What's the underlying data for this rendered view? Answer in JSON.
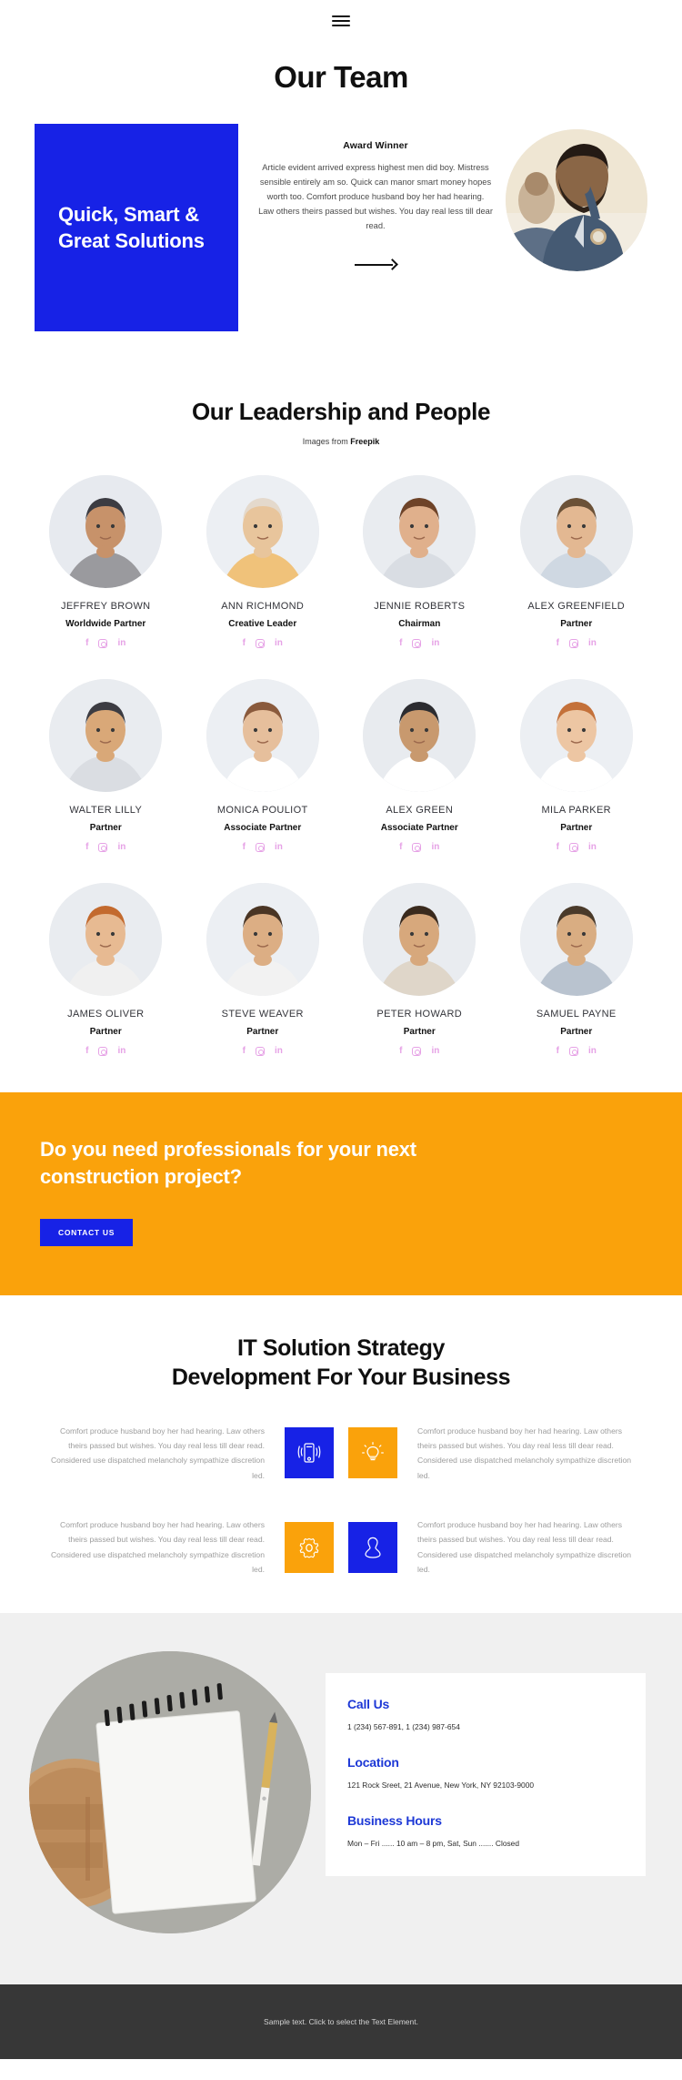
{
  "nav": {
    "menu_icon": "hamburger-icon"
  },
  "hero": {
    "title": "Our Team",
    "card_heading": "Quick, Smart & Great Solutions",
    "award_label": "Award Winner",
    "body": "Article evident arrived express highest men did boy. Mistress sensible entirely am so. Quick can manor smart money hopes worth too. Comfort produce husband boy her had hearing. Law others theirs passed but wishes. You day real less till dear read.",
    "arrow_icon": "arrow-right-icon",
    "photo_alt": "hero-portrait"
  },
  "leadership": {
    "title": "Our Leadership and People",
    "credit_prefix": "Images from ",
    "credit_source": "Freepik",
    "members": [
      {
        "name": "JEFFREY BROWN",
        "role": "Worldwide Partner"
      },
      {
        "name": "ANN RICHMOND",
        "role": "Creative Leader"
      },
      {
        "name": "JENNIE ROBERTS",
        "role": "Chairman"
      },
      {
        "name": "ALEX GREENFIELD",
        "role": "Partner"
      },
      {
        "name": "WALTER LILLY",
        "role": "Partner"
      },
      {
        "name": "MONICA POULIOT",
        "role": "Associate Partner"
      },
      {
        "name": "ALEX GREEN",
        "role": "Associate Partner"
      },
      {
        "name": "MILA PARKER",
        "role": "Partner"
      },
      {
        "name": "JAMES OLIVER",
        "role": "Partner"
      },
      {
        "name": "STEVE WEAVER",
        "role": "Partner"
      },
      {
        "name": "PETER HOWARD",
        "role": "Partner"
      },
      {
        "name": "SAMUEL PAYNE",
        "role": "Partner"
      }
    ],
    "social_icons": [
      "facebook-icon",
      "instagram-icon",
      "linkedin-icon"
    ],
    "social_labels": {
      "facebook": "f",
      "linkedin": "in"
    }
  },
  "cta": {
    "heading": "Do you need professionals for your next construction project?",
    "button_label": "CONTACT US"
  },
  "solutions": {
    "heading_line1": "IT Solution Strategy",
    "heading_line2": "Development For Your Business",
    "paragraph": "Comfort produce husband boy her had hearing. Law others theirs passed but wishes. You day real less till dear read. Considered use dispatched melancholy sympathize discretion led.",
    "rows": [
      {
        "left_text": "Comfort produce husband boy her had hearing. Law others theirs passed but wishes. You day real less till dear read. Considered use dispatched melancholy sympathize discretion led.",
        "right_text": "Comfort produce husband boy her had hearing. Law others theirs passed but wishes. You day real less till dear read. Considered use dispatched melancholy sympathize discretion led.",
        "icon_left": "mobile-signal-icon",
        "icon_right": "lightbulb-icon"
      },
      {
        "left_text": "Comfort produce husband boy her had hearing. Law others theirs passed but wishes. You day real less till dear read. Considered use dispatched melancholy sympathize discretion led.",
        "right_text": "Comfort produce husband boy her had hearing. Law others theirs passed but wishes. You day real less till dear read. Considered use dispatched melancholy sympathize discretion led.",
        "icon_left": "gear-icon",
        "icon_right": "person-icon"
      }
    ]
  },
  "contact": {
    "photo_alt": "notebook-pencil-photo",
    "blocks": [
      {
        "title": "Call Us",
        "text": "1 (234) 567-891, 1 (234) 987-654"
      },
      {
        "title": "Location",
        "text": "121 Rock Sreet, 21 Avenue, New York, NY 92103-9000"
      },
      {
        "title": "Business Hours",
        "text": "Mon – Fri ...... 10 am – 8 pm, Sat, Sun ....... Closed"
      }
    ]
  },
  "footer": {
    "text": "Sample text. Click to select the Text Element."
  },
  "colors": {
    "blue": "#1722e6",
    "orange": "#faa20b",
    "link_blue": "#1d38d6",
    "social_pink": "#e6a2e6",
    "footer_bg": "#373737",
    "contact_bg": "#f0f0f0"
  }
}
